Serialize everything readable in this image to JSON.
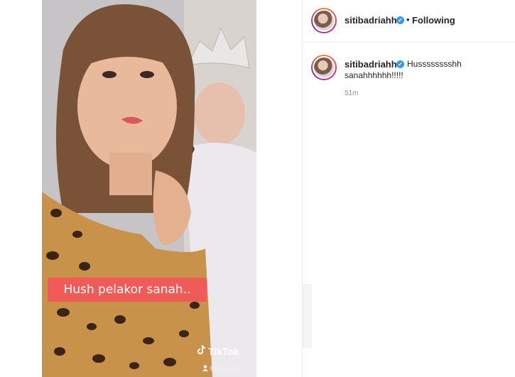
{
  "post": {
    "username": "sitibadriahh",
    "separator": "•",
    "follow_status": "Following"
  },
  "caption": {
    "username": "sitibadriahh",
    "text_line1": "Husssssssshh",
    "text_line2": "sanahhhhhh!!!!!",
    "time": "51m"
  },
  "video": {
    "overlay_text": "Hush pelakor sanah..",
    "watermark": "TikTok",
    "handle": "@krissiti911"
  },
  "icons": {
    "verified": "verified-badge-icon",
    "tiktok": "tiktok-note-icon",
    "user": "user-icon"
  },
  "colors": {
    "verified_blue": "#3897f0",
    "overlay_red": "#f05a57",
    "muted_gray": "#8e8e8e"
  }
}
